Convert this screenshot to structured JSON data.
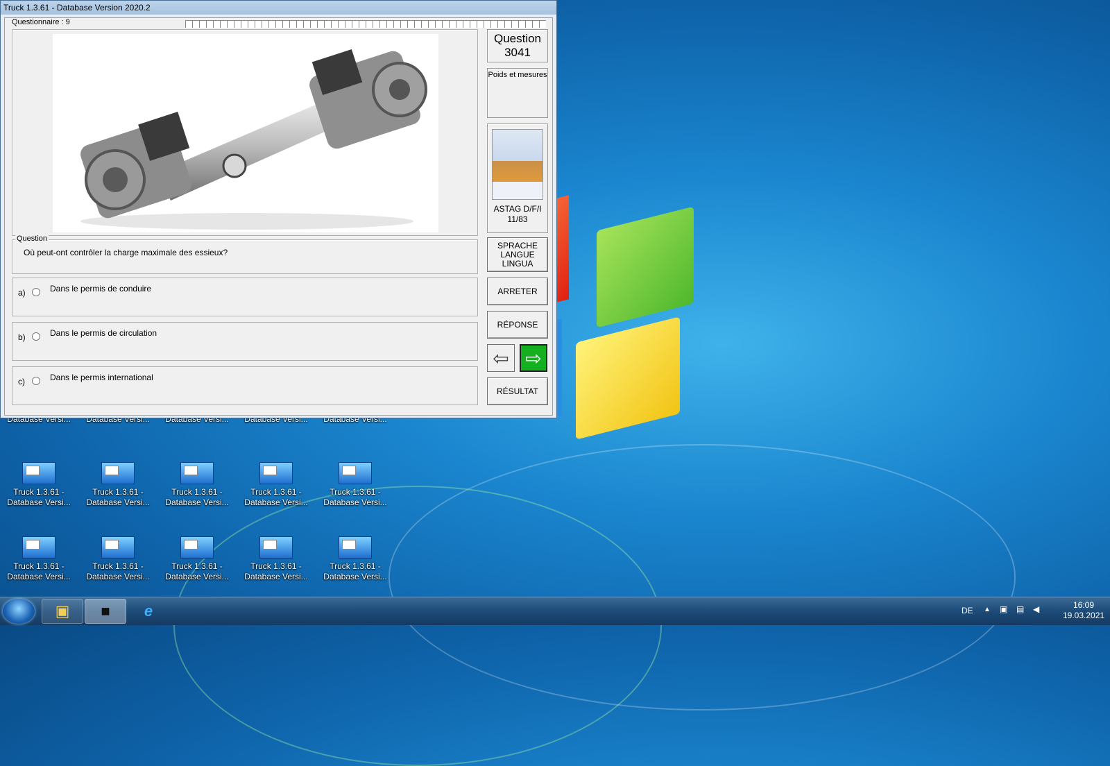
{
  "window": {
    "title": "Truck 1.3.61 - Database Version 2020.2",
    "questionnaire_label": "Questionnaire : 9"
  },
  "question_panel": {
    "group_label": "Question",
    "text": "Où peut-ont contrôler la charge maximale des essieux?"
  },
  "answers": [
    {
      "letter": "a)",
      "text": "Dans le permis de conduire"
    },
    {
      "letter": "b)",
      "text": "Dans le permis de circulation"
    },
    {
      "letter": "c)",
      "text": "Dans le permis international"
    }
  ],
  "sidebar": {
    "question_title": "Question",
    "question_number": "3041",
    "category": "Poids et mesures",
    "book_label": "ASTAG D/F/I",
    "book_ref": "11/83",
    "language_button": [
      "SPRACHE",
      "LANGUE",
      "LINGUA"
    ],
    "stop_button": "ARRETER",
    "answer_button": "RÉPONSE",
    "result_button": "RÉSULTAT"
  },
  "desktop_icons": {
    "row1": [
      "Database Versi...",
      "Database Versi...",
      "Database Versi...",
      "Database Versi...",
      "Database Versi..."
    ],
    "label_line1": "Truck 1.3.61 -",
    "label_line2": "Database Versi..."
  },
  "taskbar": {
    "language": "DE",
    "time": "16:09",
    "date": "19.03.2021"
  },
  "colors": {
    "next_button_bg": "#14b020",
    "desktop_blue": "#1a86cf"
  },
  "icons": [
    "windows-start-icon",
    "explorer-folder-icon",
    "truck-app-icon",
    "internet-explorer-icon",
    "back-arrow-icon",
    "forward-arrow-icon"
  ]
}
